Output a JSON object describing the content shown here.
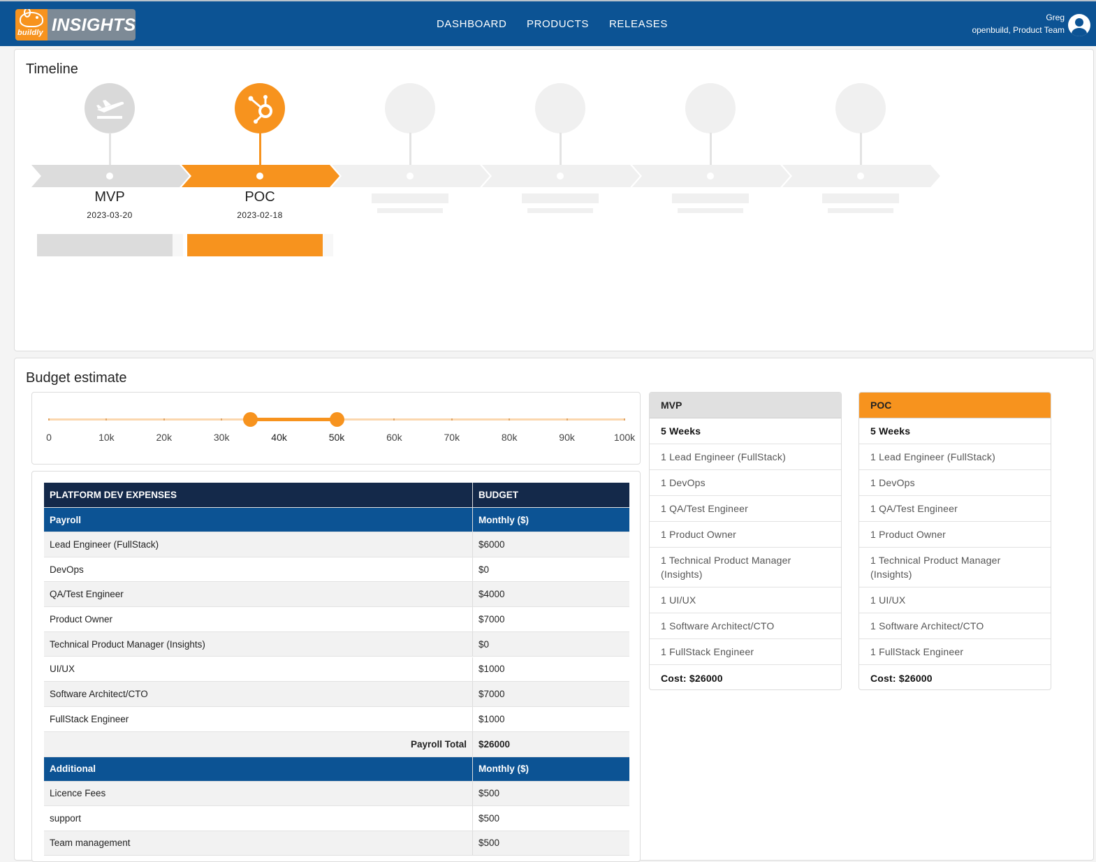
{
  "header": {
    "logo_word": "buildly",
    "logo_text": "INSIGHTS",
    "nav": [
      "DASHBOARD",
      "PRODUCTS",
      "RELEASES"
    ],
    "user_name": "Greg",
    "user_org": "openbuild, Product Team"
  },
  "timeline": {
    "title": "Timeline",
    "releases": [
      {
        "label": "MVP",
        "date": "2023-03-20",
        "icon": "airplane-takeoff-icon",
        "color": "#d9d9d9"
      },
      {
        "label": "POC",
        "date": "2023-02-18",
        "icon": "hubspot-icon",
        "color": "#f7931e"
      }
    ],
    "placeholders": 4
  },
  "budget": {
    "title": "Budget estimate",
    "slider": {
      "min": 0,
      "max": 100000,
      "step_labels": [
        "0",
        "10k",
        "20k",
        "30k",
        "40k",
        "50k",
        "60k",
        "70k",
        "80k",
        "90k",
        "100k"
      ],
      "range": [
        35000,
        50000
      ]
    },
    "table": {
      "header": [
        "PLATFORM DEV EXPENSES",
        "BUDGET"
      ],
      "payroll_section": [
        "Payroll",
        "Monthly ($)"
      ],
      "payroll": [
        [
          "Lead Engineer (FullStack)",
          "$6000"
        ],
        [
          "DevOps",
          "$0"
        ],
        [
          "QA/Test Engineer",
          "$4000"
        ],
        [
          "Product Owner",
          "$7000"
        ],
        [
          "Technical Product Manager (Insights)",
          "$0"
        ],
        [
          "UI/UX",
          "$1000"
        ],
        [
          "Software Architect/CTO",
          "$7000"
        ],
        [
          "FullStack Engineer",
          "$1000"
        ]
      ],
      "payroll_total": [
        "Payroll Total",
        "$26000"
      ],
      "additional_section": [
        "Additional",
        "Monthly ($)"
      ],
      "additional": [
        [
          "Licence Fees",
          "$500"
        ],
        [
          "support",
          "$500"
        ],
        [
          "Team management",
          "$500"
        ]
      ]
    },
    "cards": [
      {
        "name": "MVP",
        "color": "#e0e0e0",
        "text_color": "#222",
        "weeks": "5 Weeks",
        "items": [
          "1 Lead Engineer (FullStack)",
          "1 DevOps",
          "1 QA/Test Engineer",
          "1 Product Owner",
          "1 Technical Product Manager (Insights)",
          "1 UI/UX",
          "1 Software Architect/CTO",
          "1 FullStack Engineer"
        ],
        "cost": "Cost: $26000"
      },
      {
        "name": "POC",
        "color": "#f7931e",
        "text_color": "#222",
        "weeks": "5 Weeks",
        "items": [
          "1 Lead Engineer (FullStack)",
          "1 DevOps",
          "1 QA/Test Engineer",
          "1 Product Owner",
          "1 Technical Product Manager (Insights)",
          "1 UI/UX",
          "1 Software Architect/CTO",
          "1 FullStack Engineer"
        ],
        "cost": "Cost: $26000"
      }
    ]
  }
}
